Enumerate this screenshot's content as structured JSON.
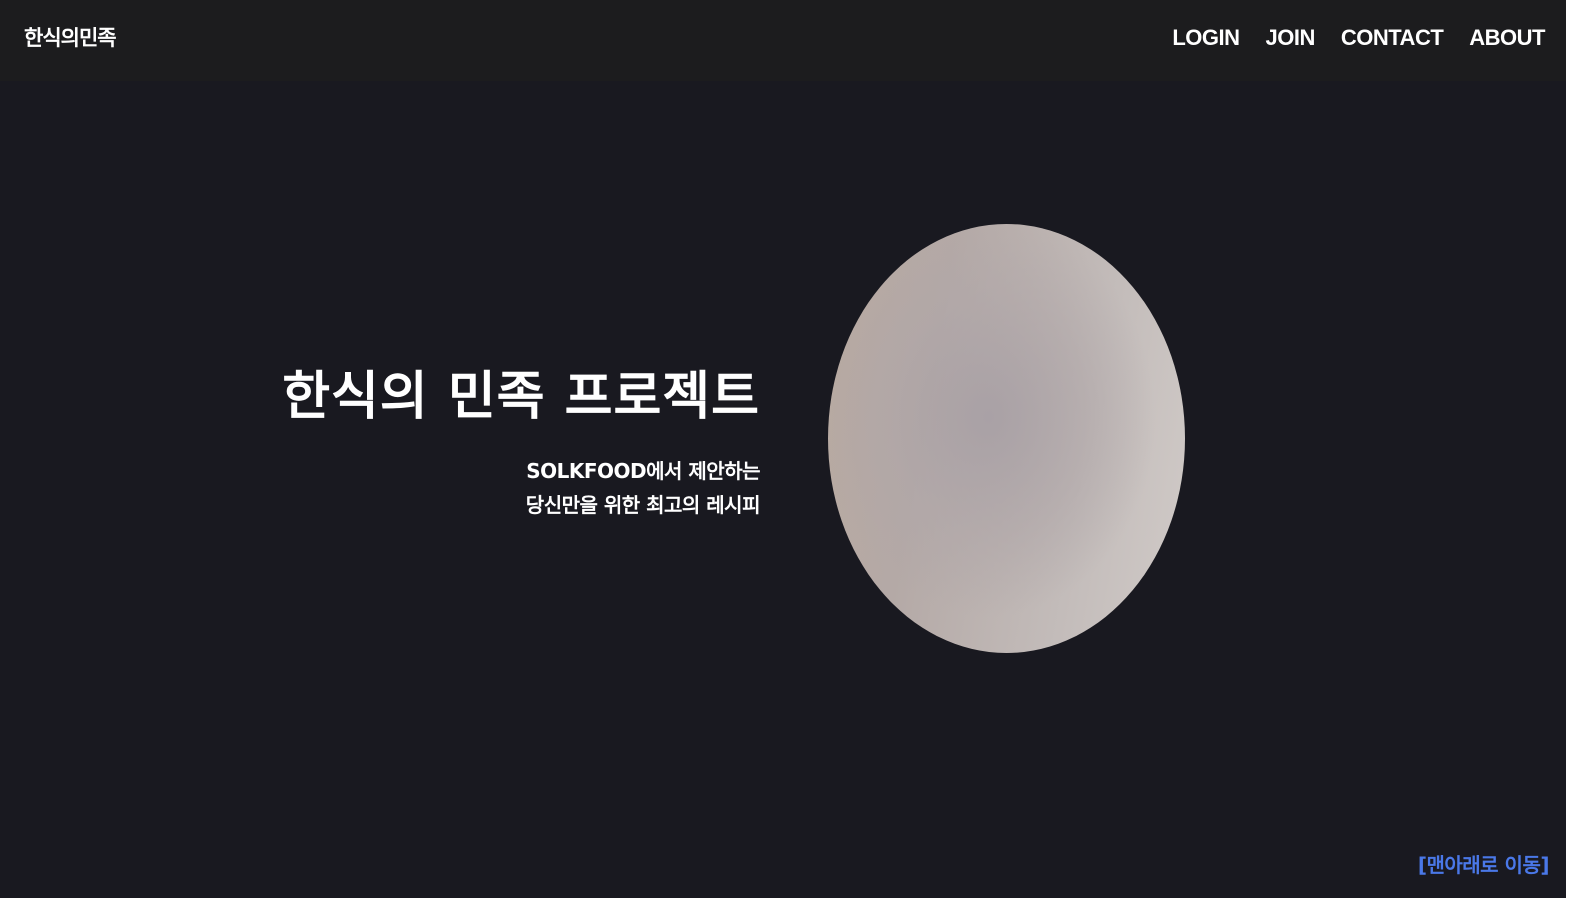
{
  "header": {
    "brand": "한식의민족",
    "nav": [
      {
        "label": "LOGIN"
      },
      {
        "label": "JOIN"
      },
      {
        "label": "CONTACT"
      },
      {
        "label": "ABOUT"
      }
    ]
  },
  "hero": {
    "title": "한식의 민족 프로젝트",
    "subtitle_line1": "SOLKFOOD에서 제안하는",
    "subtitle_line2": "당신만을 위한 최고의 레시피"
  },
  "footer_link": {
    "label": "[맨아래로 이동]"
  },
  "colors": {
    "background": "#191920",
    "navbar": "#1c1c1e",
    "text": "#ffffff",
    "link_accent": "#4a78e8"
  }
}
